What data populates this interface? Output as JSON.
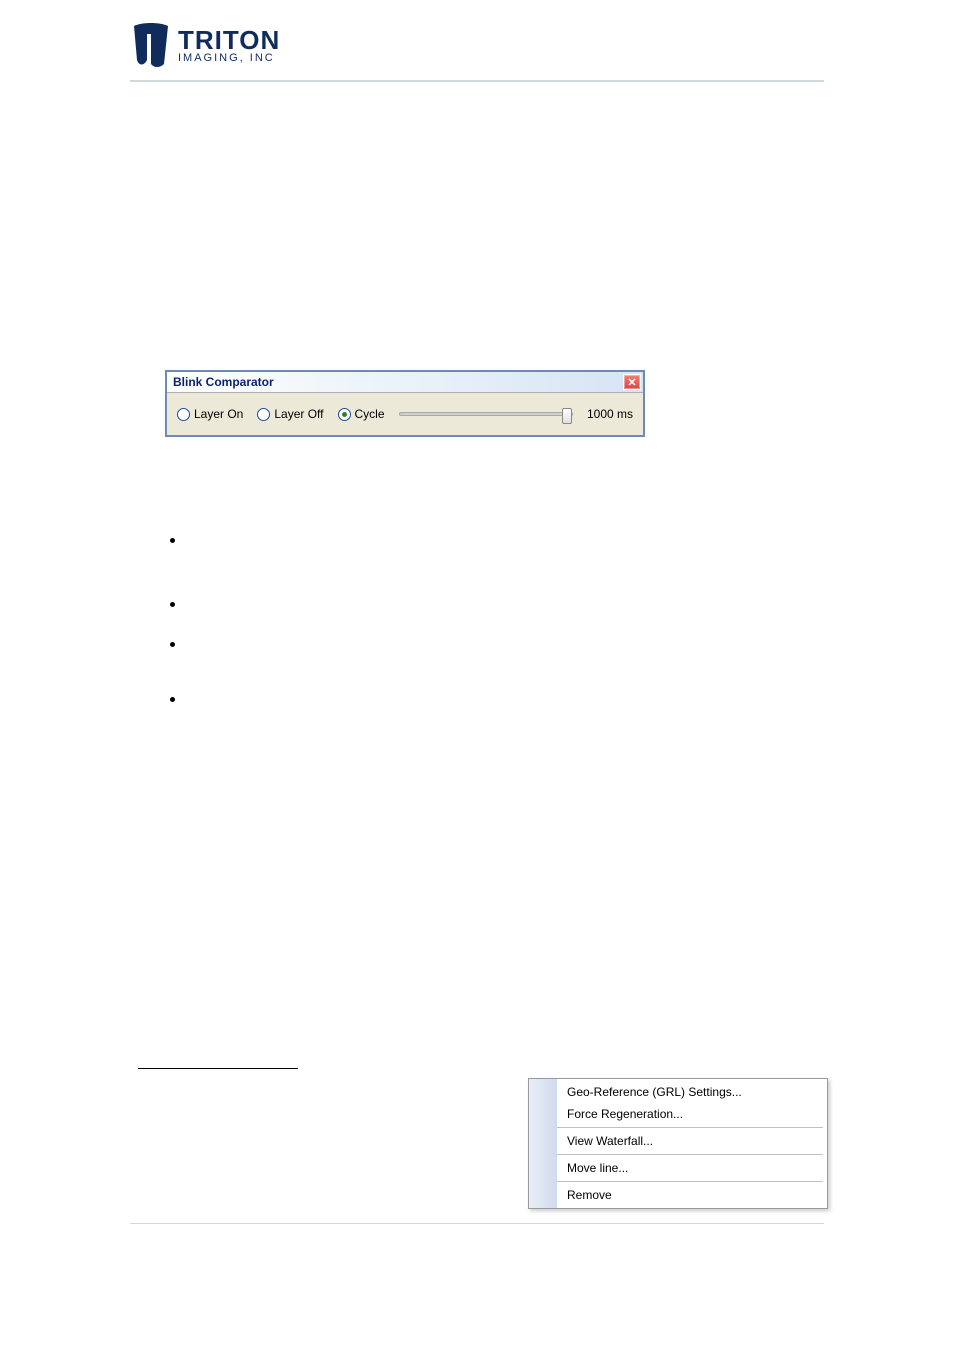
{
  "logo": {
    "main": "TRITON",
    "sub": "IMAGING, INC"
  },
  "dialog": {
    "title": "Blink Comparator",
    "close_glyph": "✕",
    "layer_on": "Layer On",
    "layer_off": "Layer Off",
    "cycle": "Cycle",
    "time_value": "1000 ms"
  },
  "context_menu": {
    "items": [
      "Geo-Reference (GRL) Settings...",
      "Force Regeneration...",
      "View Waterfall...",
      "Move line...",
      "Remove"
    ]
  }
}
